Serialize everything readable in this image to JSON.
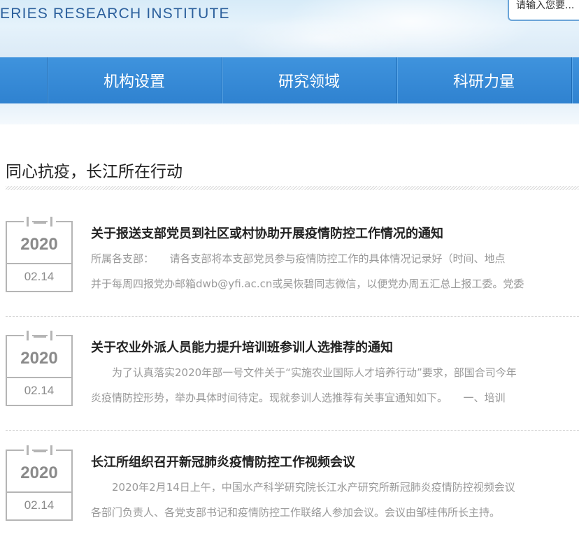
{
  "header": {
    "institute_name": "ERIES RESEARCH INSTITUTE",
    "search_placeholder": "请输入您要..."
  },
  "nav": {
    "items": [
      {
        "label": "机构设置"
      },
      {
        "label": "研究领域"
      },
      {
        "label": "科研力量"
      }
    ]
  },
  "section": {
    "title": "同心抗疫，长江所在行动"
  },
  "news": [
    {
      "year": "2020",
      "day": "02.14",
      "title": "关于报送支部党员到社区或村协助开展疫情防控工作情况的通知",
      "line1": "所属各支部：　　请各支部将本支部党员参与疫情防控工作的具体情况记录好（时间、地点",
      "line2": "并于每周四报党办邮箱dwb@yfi.ac.cn或吴恢碧同志微信，以便党办周五汇总上报工委。党委"
    },
    {
      "year": "2020",
      "day": "02.14",
      "title": "关于农业外派人员能力提升培训班参训人选推荐的通知",
      "line1": "　　为了认真落实2020年部一号文件关于“实施农业国际人才培养行动”要求，部国合司今年",
      "line2": "炎疫情防控形势，举办具体时间待定。现就参训人选推荐有关事宜通知如下。　　一、培训"
    },
    {
      "year": "2020",
      "day": "02.14",
      "title": "长江所组织召开新冠肺炎疫情防控工作视频会议",
      "line1": "　　2020年2月14日上午，中国水产科学研究院长江水产研究所新冠肺炎疫情防控视频会议",
      "line2": "各部门负责人、各党支部书记和疫情防控工作联络人参加会议。会议由邹桂伟所长主持。"
    }
  ]
}
